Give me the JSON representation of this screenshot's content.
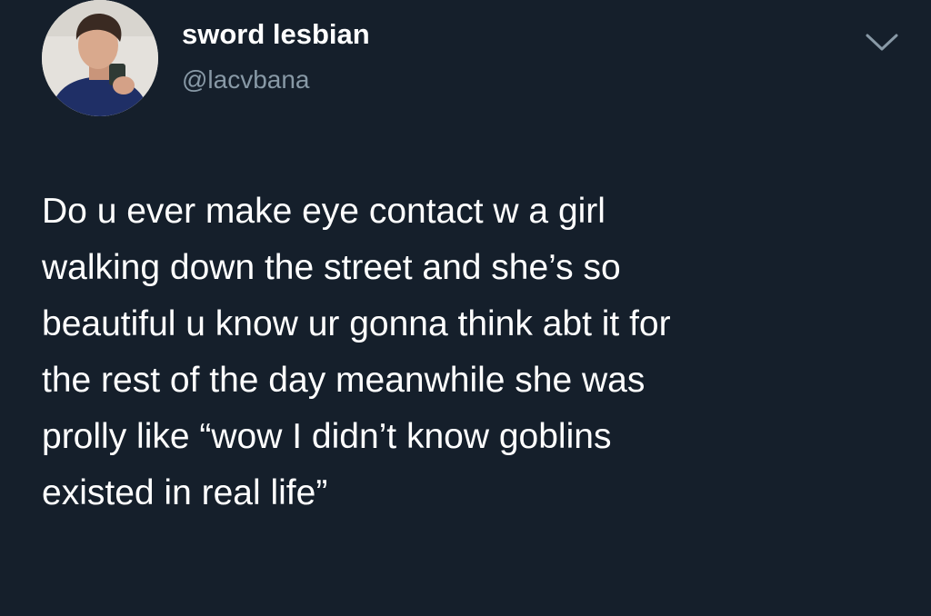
{
  "author": {
    "display_name": "sword lesbian",
    "handle": "@lacvbana",
    "avatar_icon": "profile-photo"
  },
  "menu": {
    "icon": "chevron-down-icon"
  },
  "tweet": {
    "lines": [
      "Do u ever make eye contact w a girl",
      "walking down the street and she’s so",
      "beautiful u know ur gonna think abt it for",
      "the rest of the day meanwhile she was",
      "prolly like “wow I didn’t know goblins",
      "existed in real life”"
    ]
  },
  "colors": {
    "background": "#151f2b",
    "text": "#ffffff",
    "secondary": "#8899a6"
  }
}
